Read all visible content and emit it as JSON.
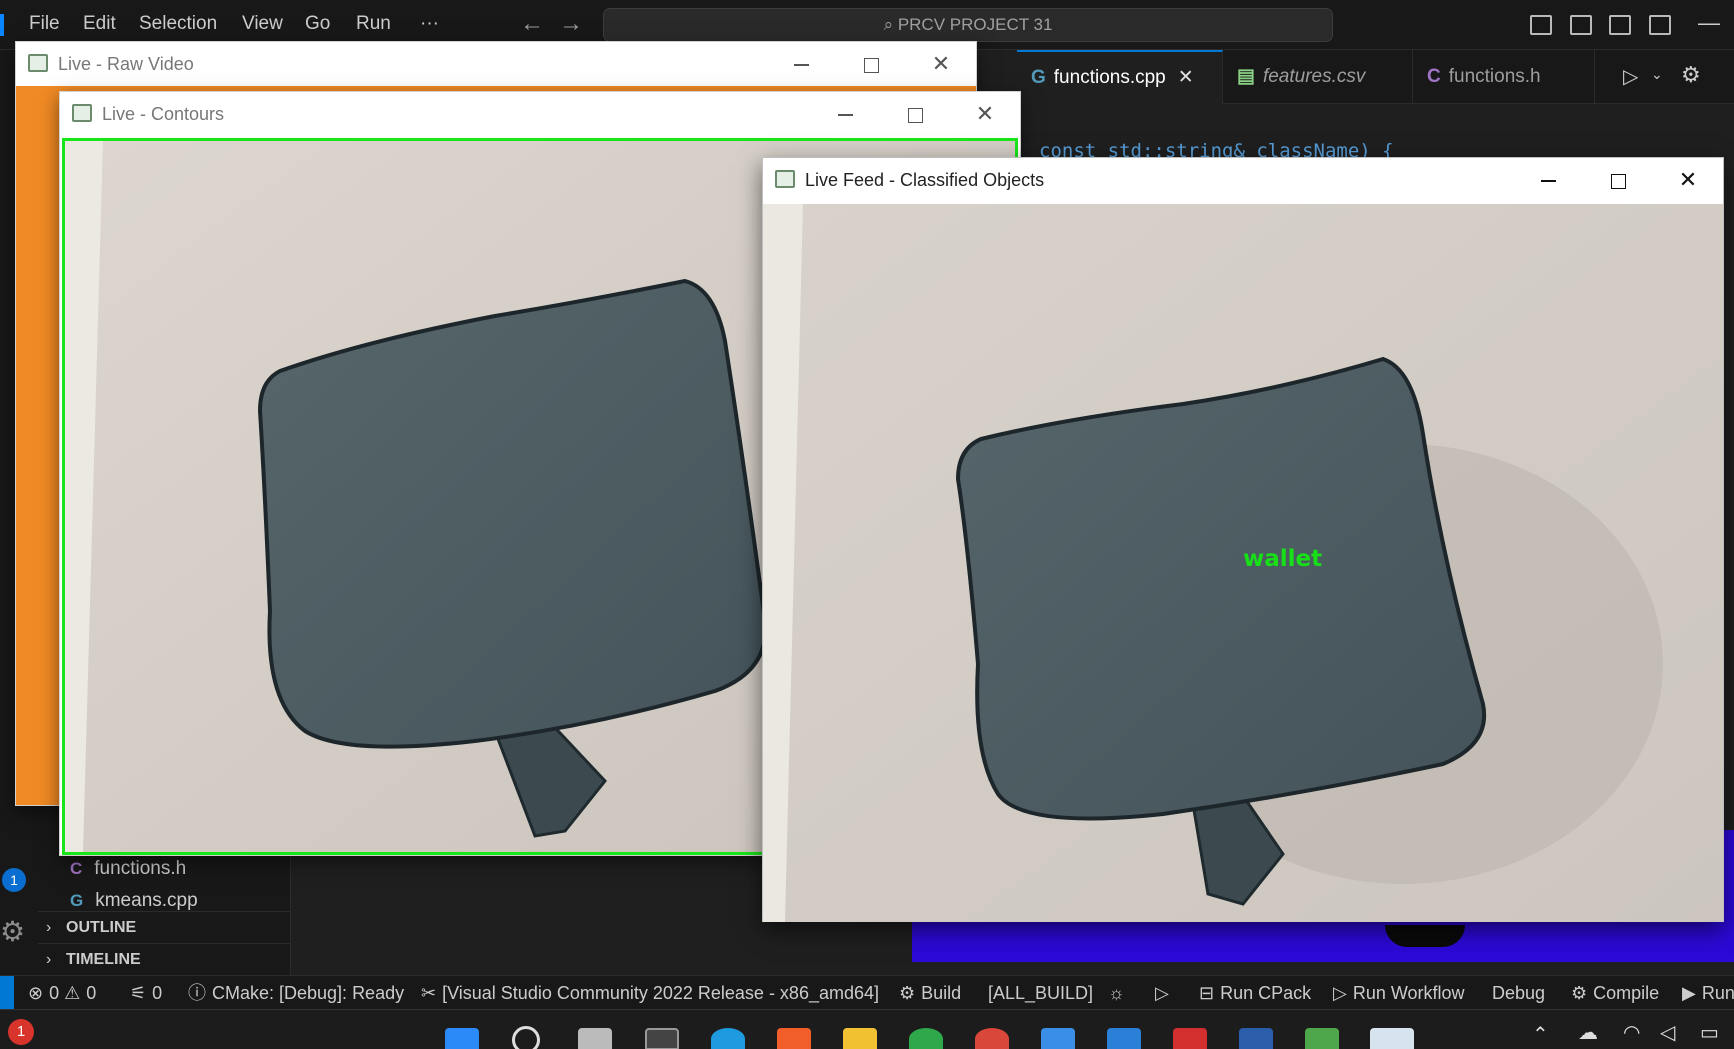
{
  "menu": [
    "File",
    "Edit",
    "Selection",
    "View",
    "Go",
    "Run",
    "···"
  ],
  "command_center": "PRCV PROJECT 31",
  "editor": {
    "tabs": [
      {
        "label": "functions.cpp",
        "icon": "cpp-file-icon",
        "active": true,
        "icon_text": "G"
      },
      {
        "label": "features.csv",
        "icon": "csv-file-icon",
        "active": false,
        "icon_text": "▤"
      },
      {
        "label": "functions.h",
        "icon": "c-header-file-icon",
        "active": false,
        "icon_text": "C"
      }
    ],
    "code_visible": "const std::string& className) {"
  },
  "sidebar": {
    "files": [
      {
        "label": "functions.h",
        "icon_text": "C"
      },
      {
        "label": "kmeans.cpp",
        "icon_text": "G"
      }
    ],
    "sections": [
      "OUTLINE",
      "TIMELINE"
    ],
    "badge": "1"
  },
  "windows": {
    "raw": {
      "title": "Live - Raw Video"
    },
    "contours": {
      "title": "Live - Contours"
    },
    "classified": {
      "title": "Live Feed - Classified Objects",
      "detected_label": "wallet"
    }
  },
  "statusbar": {
    "errors": "0",
    "warnings": "0",
    "ports": "0",
    "cmake_status": "CMake: [Debug]: Ready",
    "kit": "[Visual Studio Community 2022 Release - x86_amd64]",
    "build": "Build",
    "target": "[ALL_BUILD]",
    "cpack": "Run CPack",
    "workflow": "Run Workflow",
    "debug": "Debug",
    "compile": "Compile",
    "run": "Run"
  },
  "taskbar": {
    "notification_count": "1"
  },
  "colors": {
    "accent": "#0078d4",
    "contour": "#19e619",
    "label": "#18e018",
    "raw_fill": "#f08a24",
    "purple": "#2c09d6"
  }
}
